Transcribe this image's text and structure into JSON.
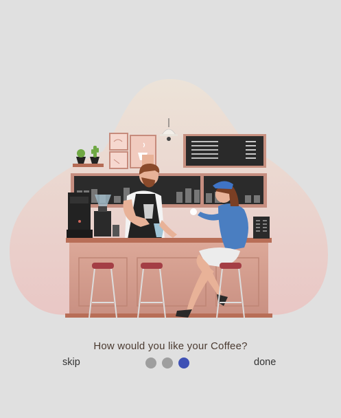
{
  "onboarding": {
    "caption": "How would you like your Coffee?",
    "skip_label": "skip",
    "done_label": "done",
    "total_pages": 3,
    "current_page": 3,
    "colors": {
      "background": "#e0e0e0",
      "dot_inactive": "#9e9e9e",
      "dot_active": "#3f51b5"
    },
    "illustration": "barista-serving-coffee-illustration"
  }
}
